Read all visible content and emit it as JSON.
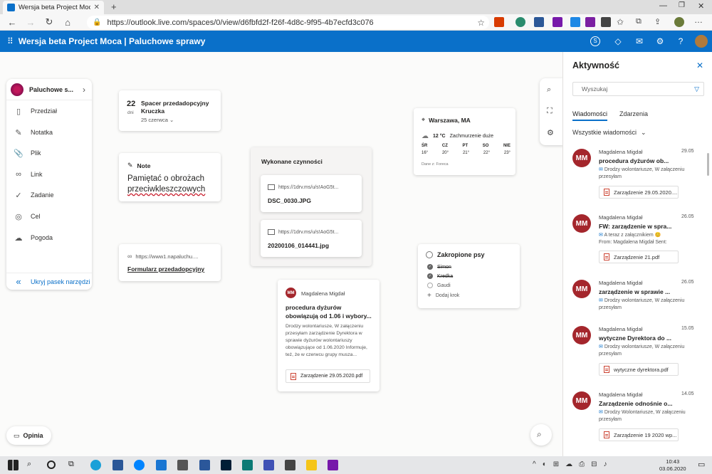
{
  "browser": {
    "tab_title": "Wersja beta Project Moca | Palu",
    "url": "https://outlook.live.com/spaces/0/view/d6fbfd2f-f26f-4d8c-9f95-4b7ecfd3c076"
  },
  "appbar": {
    "title": "Wersja beta Project Moca | Paluchowe sprawy"
  },
  "sidebar": {
    "space_name": "Paluchowe s...",
    "items": [
      {
        "label": "Przedział",
        "icon": "divider-icon"
      },
      {
        "label": "Notatka",
        "icon": "note-icon"
      },
      {
        "label": "Plik",
        "icon": "paperclip-icon"
      },
      {
        "label": "Link",
        "icon": "link-icon"
      },
      {
        "label": "Zadanie",
        "icon": "task-icon"
      },
      {
        "label": "Cel",
        "icon": "goal-icon"
      },
      {
        "label": "Pogoda",
        "icon": "weather-icon"
      }
    ],
    "hide_label": "Ukryj pasek narzędzi"
  },
  "cards": {
    "event": {
      "day": "22",
      "day_label": "dni",
      "title": "Spacer przedadopcyjny Kruczka",
      "date": "25 czerwca"
    },
    "note": {
      "header": "Note",
      "text_line1": "Pamiętać o obrożach",
      "text_line2": "przeciwkleszczowych"
    },
    "link": {
      "url": "https://www1.napaluchu....",
      "title": "Formularz przedadopcyjny"
    },
    "done": {
      "title": "Wykonane czynności",
      "files": [
        {
          "url": "https://1drv.ms/u/s!AoG5t...",
          "name": "DSC_0030.JPG"
        },
        {
          "url": "https://1drv.ms/u/s!AoG5t...",
          "name": "20200106_014441.jpg"
        }
      ]
    },
    "weather": {
      "location": "Warszawa, MA",
      "current": "12 °C",
      "condition": "Zachmurzenie duże",
      "days": [
        "ŚR",
        "CZ",
        "PT",
        "SO",
        "NIE"
      ],
      "temps": [
        "16°",
        "20°",
        "21°",
        "22°",
        "23°"
      ],
      "source": "Dane z: Foreca"
    },
    "email": {
      "sender_initials": "MM",
      "sender": "Magdalena Migdał",
      "subject": "procedura dyżurów obowiązują od 1.06 i wybory...",
      "body": "Drodzy wolontariusze,  W załączeniu przesyłam zarządzenie Dyrektora w sprawie dyżurów wolontariuszy obowiązujące od 1.06.2020  Informuje, też, że w czerwcu grupy musza...",
      "attachment": "Zarządzenie 29.05.2020.pdf"
    },
    "tasks": {
      "title": "Zakropione psy",
      "items": [
        {
          "label": "Simon",
          "done": true
        },
        {
          "label": "Kredka",
          "done": true
        },
        {
          "label": "Gaudi",
          "done": false
        }
      ],
      "add_label": "Dodaj krok"
    }
  },
  "opinion_label": "Opinia",
  "panel": {
    "title": "Aktywność",
    "search_placeholder": "Wyszukaj",
    "tabs": [
      "Wiadomości",
      "Zdarzenia"
    ],
    "filter": "Wszystkie wiadomości",
    "messages": [
      {
        "initials": "MM",
        "from": "Magdalena Migdał",
        "date": "29.05",
        "subject": "procedura dyżurów ob...",
        "preview": "Drodzy wolontariusze, W załączeniu przesyłam",
        "from_line": "",
        "attachment": "Zarządzenie 29.05.2020...."
      },
      {
        "initials": "MM",
        "from": "Magdalena Migdał",
        "date": "26.05",
        "subject": "FW: zarządzenie w spra...",
        "preview": "A teraz z załącznikiem 😊",
        "from_line": "From: Magdalena Migdał Sent:",
        "attachment": "Zarządzenie 21.pdf"
      },
      {
        "initials": "MM",
        "from": "Magdalena Migdał",
        "date": "26.05",
        "subject": "zarządzenie w sprawie ...",
        "preview": "Drodzy wolontariusze, W załączeniu przesyłam",
        "from_line": "",
        "attachment": ""
      },
      {
        "initials": "MM",
        "from": "Magdalena Migdał",
        "date": "15.05",
        "subject": "wytyczne Dyrektora do ...",
        "preview": "Drodzy wolontariusze, W załączeniu przesyłam",
        "from_line": "",
        "attachment": "wytyczne dyrektora.pdf"
      },
      {
        "initials": "MM",
        "from": "Magdalena Migdał",
        "date": "14.05",
        "subject": "Zarządzenie odnośnie o...",
        "preview": "Drodzy Wolontariusze, W załączeniu przesyłam",
        "from_line": "",
        "attachment": "Zarządzenie 19 2020 wp..."
      }
    ]
  },
  "taskbar": {
    "time": "10:43",
    "date": "03.06.2020"
  }
}
